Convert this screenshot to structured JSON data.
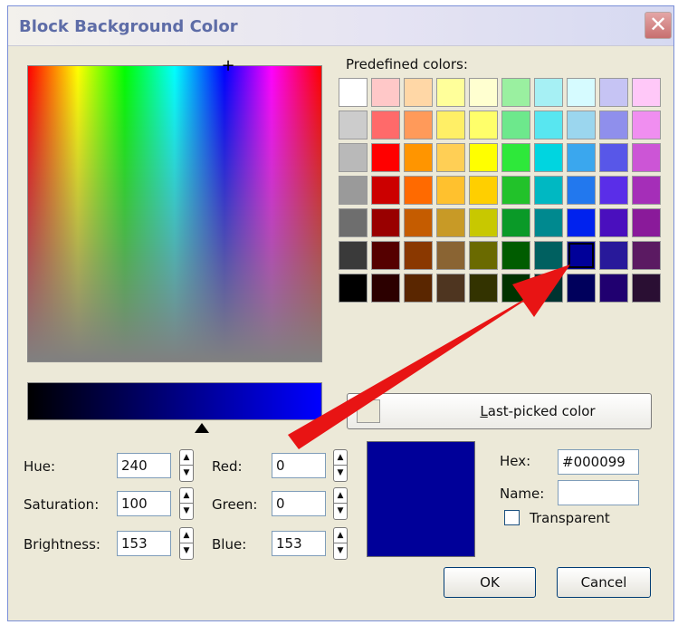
{
  "dialog": {
    "title": "Block Background Color",
    "close_glyph": "✕"
  },
  "spectrum": {
    "cursor_glyph": "+"
  },
  "predefined": {
    "label": "Predefined colors:",
    "selected_color": "#000099",
    "rows": [
      [
        "#ffffff",
        "#ffc8c8",
        "#ffd7a6",
        "#ffff9a",
        "#ffffd0",
        "#9af0a0",
        "#a6f0f4",
        "#d6fbff",
        "#c6c4f4",
        "#ffc8f8"
      ],
      [
        "#cccccc",
        "#ff6a6a",
        "#ff9a5a",
        "#ffef66",
        "#ffff6a",
        "#6de88c",
        "#58e6f0",
        "#9bd6ee",
        "#8f8fec",
        "#f08ef0"
      ],
      [
        "#b9b9b9",
        "#ff0000",
        "#ff9500",
        "#ffcf55",
        "#ffff00",
        "#2ee83a",
        "#00d5e0",
        "#3aa7ee",
        "#5857e8",
        "#cc55d6"
      ],
      [
        "#9a9a9a",
        "#cc0000",
        "#ff6a00",
        "#ffc12e",
        "#ffcf00",
        "#22c22a",
        "#00b8c2",
        "#2278ee",
        "#5a2ee8",
        "#a52eb8"
      ],
      [
        "#6e6e6e",
        "#990000",
        "#c55c00",
        "#c89a26",
        "#c8c800",
        "#0a9a28",
        "#00898f",
        "#0022ee",
        "#4a0fbe",
        "#8a1a9a"
      ],
      [
        "#3a3a3a",
        "#550000",
        "#8a3800",
        "#8a6433",
        "#6a6a00",
        "#005c00",
        "#006060",
        "#000099",
        "#28199a",
        "#5b1a62"
      ],
      [
        "#000000",
        "#2c0000",
        "#5a2600",
        "#4e3520",
        "#333300",
        "#003300",
        "#003330",
        "#00005c",
        "#200070",
        "#2a0f33"
      ]
    ]
  },
  "brightness_bar": {
    "pointer_glyph": "▲"
  },
  "fields": {
    "hue": {
      "label": "Hue:",
      "value": "240"
    },
    "saturation": {
      "label": "Saturation:",
      "value": "100"
    },
    "brightness": {
      "label": "Brightness:",
      "value": "153"
    },
    "red": {
      "label": "Red:",
      "value": "0"
    },
    "green": {
      "label": "Green:",
      "value": "0"
    },
    "blue": {
      "label": "Blue:",
      "value": "153"
    },
    "hex": {
      "label": "Hex:",
      "value": "#000099"
    },
    "name": {
      "label": "Name:",
      "value": ""
    }
  },
  "spinner": {
    "up_glyph": "▲",
    "down_glyph": "▼"
  },
  "preview": {
    "color": "#000099"
  },
  "transparent": {
    "label": "Transparent",
    "checked": false
  },
  "buttons": {
    "last_picked_accel": "L",
    "last_picked_rest": "ast-picked color",
    "ok": "OK",
    "cancel": "Cancel"
  },
  "colors": {
    "annotation_arrow": "#e81414",
    "title_text": "#5d6ca7",
    "dialog_bg": "#ece9d8"
  }
}
